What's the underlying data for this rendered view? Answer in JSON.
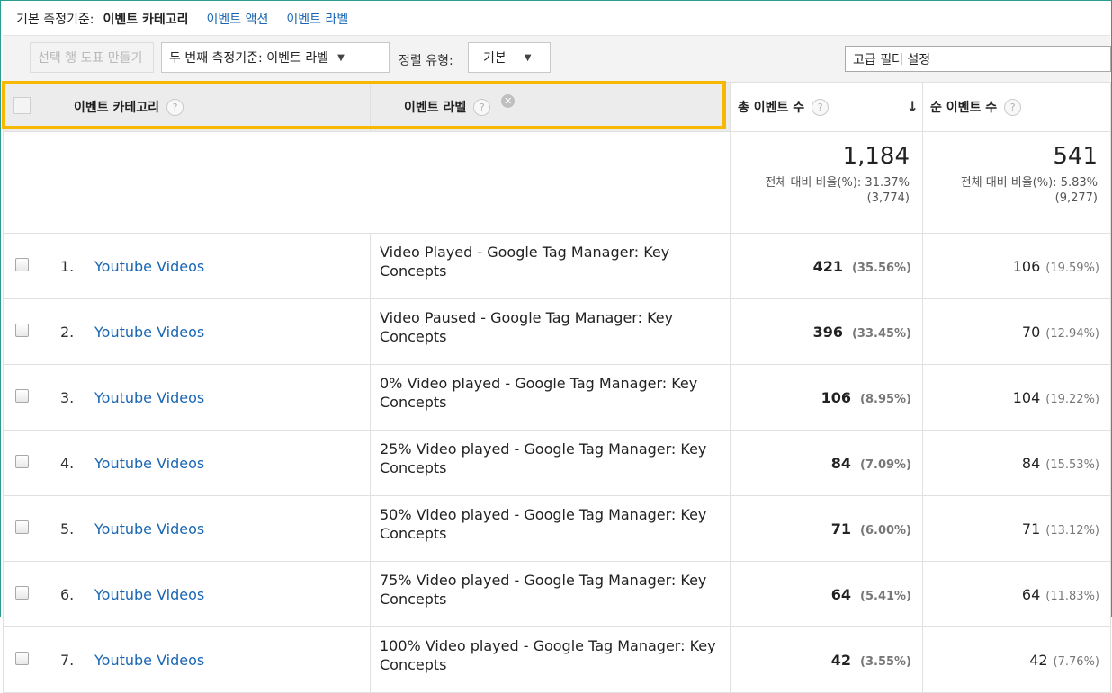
{
  "dimension_bar": {
    "label": "기본 측정기준:",
    "current": "이벤트 카테고리",
    "options": [
      "이벤트 액션",
      "이벤트 라벨"
    ]
  },
  "toolbar": {
    "create_chart_label": "선택 행 도표 만들기",
    "secondary_dim_label": "두 번째 측정기준: 이벤트 라벨",
    "sort_type_label": "정렬 유형:",
    "sort_value": "기본",
    "advanced_filter_label": "고급 필터 설정"
  },
  "table": {
    "headers": {
      "category": "이벤트 카테고리",
      "label": "이벤트 라벨",
      "total_events": "총 이벤트 수",
      "unique_events": "순 이벤트 수"
    },
    "summary": {
      "total": "1,184",
      "total_detail": "전체 대비 비율(%): 31.37%",
      "total_base": "(3,774)",
      "unique": "541",
      "unique_detail": "전체 대비 비율(%): 5.83%",
      "unique_base": "(9,277)"
    },
    "rows": [
      {
        "num": "1.",
        "category": "Youtube Videos",
        "label": "Video Played - Google Tag Manager: Key Concepts",
        "total": "421",
        "total_pct": "(35.56%)",
        "unique": "106",
        "unique_pct": "(19.59%)"
      },
      {
        "num": "2.",
        "category": "Youtube Videos",
        "label": "Video Paused - Google Tag Manager: Key Concepts",
        "total": "396",
        "total_pct": "(33.45%)",
        "unique": "70",
        "unique_pct": "(12.94%)"
      },
      {
        "num": "3.",
        "category": "Youtube Videos",
        "label": "0% Video played - Google Tag Manager: Key Concepts",
        "total": "106",
        "total_pct": "(8.95%)",
        "unique": "104",
        "unique_pct": "(19.22%)"
      },
      {
        "num": "4.",
        "category": "Youtube Videos",
        "label": "25% Video played - Google Tag Manager: Key Concepts",
        "total": "84",
        "total_pct": "(7.09%)",
        "unique": "84",
        "unique_pct": "(15.53%)"
      },
      {
        "num": "5.",
        "category": "Youtube Videos",
        "label": "50% Video played - Google Tag Manager: Key Concepts",
        "total": "71",
        "total_pct": "(6.00%)",
        "unique": "71",
        "unique_pct": "(13.12%)"
      },
      {
        "num": "6.",
        "category": "Youtube Videos",
        "label": "75% Video played - Google Tag Manager: Key Concepts",
        "total": "64",
        "total_pct": "(5.41%)",
        "unique": "64",
        "unique_pct": "(11.83%)"
      },
      {
        "num": "7.",
        "category": "Youtube Videos",
        "label": "100% Video played - Google Tag Manager: Key Concepts",
        "total": "42",
        "total_pct": "(3.55%)",
        "unique": "42",
        "unique_pct": "(7.76%)"
      }
    ]
  },
  "icons": {
    "help": "question-circle-icon",
    "remove": "close-circle-icon",
    "sort": "arrow-down-icon",
    "dropdown": "caret-down-icon"
  },
  "colors": {
    "link": "#1a66b3",
    "highlight": "#f6b800",
    "frame": "#2a9d8f"
  }
}
